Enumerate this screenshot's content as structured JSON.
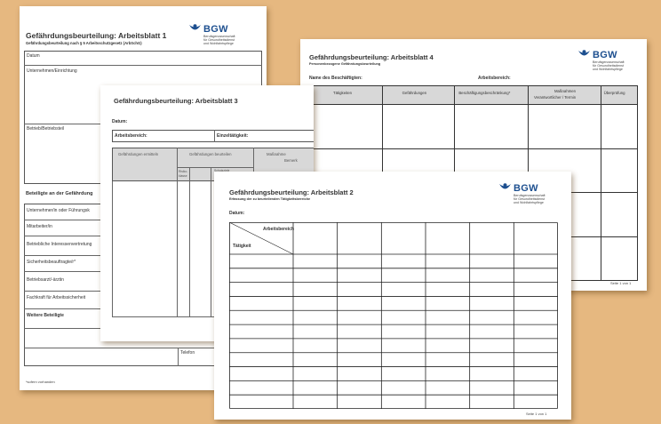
{
  "bgw_logo": {
    "brand": "BGW",
    "line1": "Berufsgenossenschaft",
    "line2": "für Gesundheitsdienst",
    "line3": "und Wohlfahrtspflege",
    "blue": "#1d4f8f"
  },
  "sheet1": {
    "title": "Gefährdungsbeurteilung: Arbeitsblatt 1",
    "subtitle": "Gefährdungsbeurteilung nach § 5 Arbeitsschutzgesetz (ArbSchG)",
    "fields": [
      "Datum",
      "Unternehmen/Einrichtung",
      "Betrieb/Betriebsteil"
    ],
    "participants_heading": "Beteiligte an der Gefährdung",
    "participants": [
      "Unternehmer/in oder Führungsk",
      "Mitarbeiter/in",
      "Betriebliche Interessenvertretung",
      "Sicherheitsbeauftragte/r*",
      "Betriebsarzt/-ärztin",
      "Fachkraft für Arbeitssicherheit",
      "Weitere Beteiligte"
    ],
    "telefon": "Telefon",
    "footnote": "*sofern vorhanden"
  },
  "sheet3": {
    "title": "Gefährdungsbeurteilung: Arbeitsblatt 3",
    "datum": "Datum:",
    "arbeitsbereich": "Arbeitsbereich:",
    "einzeltaetigkeit": "Einzeltätigkeit:",
    "col_ermitteln": "Gefährdungen ermitteln",
    "col_beurteilen": "Gefährdungen beurteilen",
    "col_massnahmen_1": "Maßnahme",
    "col_massnahmen_2": "Bemerk",
    "sub_risiko_1": "Risiko-",
    "sub_risiko_2": "klasse",
    "sub_schutzziele": "Schutzziele"
  },
  "sheet4": {
    "title": "Gefährdungsbeurteilung: Arbeitsblatt 4",
    "subtitle": "Personenbezogene Gefährdungsbeurteilung",
    "name_label": "Name des Beschäftigten:",
    "arbeitsbereich": "Arbeitsbereich:",
    "columns": [
      "Tätigkeiten",
      "Gefährdungen",
      "Beschäftigungsbeschränkung*",
      "Maßnahmen",
      "Überprüfung"
    ],
    "col4_line2": "Verantwortlicher / Termin",
    "footer": "Seite 1 von 1"
  },
  "sheet2": {
    "title": "Gefährdungsbeurteilung: Arbeitsblatt 2",
    "subtitle": "Erfassung der zu beurteilenden Tätigkeitsbereiche",
    "datum": "Datum:",
    "diag_top": "Arbeitsbereich",
    "diag_bottom": "Tätigkeit",
    "footer": "Seite 1 von 1"
  }
}
